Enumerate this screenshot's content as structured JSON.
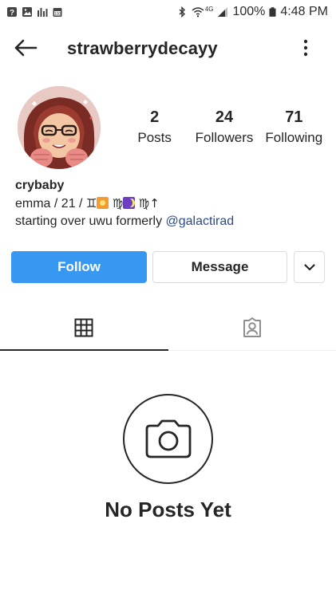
{
  "status_bar": {
    "battery_percent": "100%",
    "time": "4:48 PM",
    "network": "4G",
    "icons": [
      "question-box-icon",
      "gallery-icon",
      "equalizer-icon",
      "calendar-icon",
      "bluetooth-icon",
      "wifi-icon",
      "signal-icon",
      "battery-icon"
    ]
  },
  "header": {
    "username": "strawberrydecayy",
    "back_icon": "arrow-left-icon",
    "more_icon": "vertical-dots-icon"
  },
  "profile": {
    "stats": [
      {
        "value": "2",
        "label": "Posts"
      },
      {
        "value": "24",
        "label": "Followers"
      },
      {
        "value": "71",
        "label": "Following"
      }
    ],
    "bio": {
      "name": "crybaby",
      "line1_prefix": "emma / 21 /",
      "gemini_symbol": "♊",
      "virgo_symbol": "♍",
      "arrow": "↑",
      "line2_text": "starting over uwu formerly",
      "mention": "@galactirad"
    }
  },
  "actions": {
    "follow_label": "Follow",
    "message_label": "Message",
    "dropdown_icon": "chevron-down-icon"
  },
  "tabs": [
    {
      "name": "grid",
      "icon": "grid-icon",
      "active": true
    },
    {
      "name": "tagged",
      "icon": "tagged-person-icon",
      "active": false
    }
  ],
  "empty_state": {
    "icon": "camera-icon",
    "title": "No Posts Yet"
  },
  "colors": {
    "accent": "#3897f0",
    "text": "#262626",
    "link": "#2b4a8c",
    "border": "#dbdbdb"
  }
}
